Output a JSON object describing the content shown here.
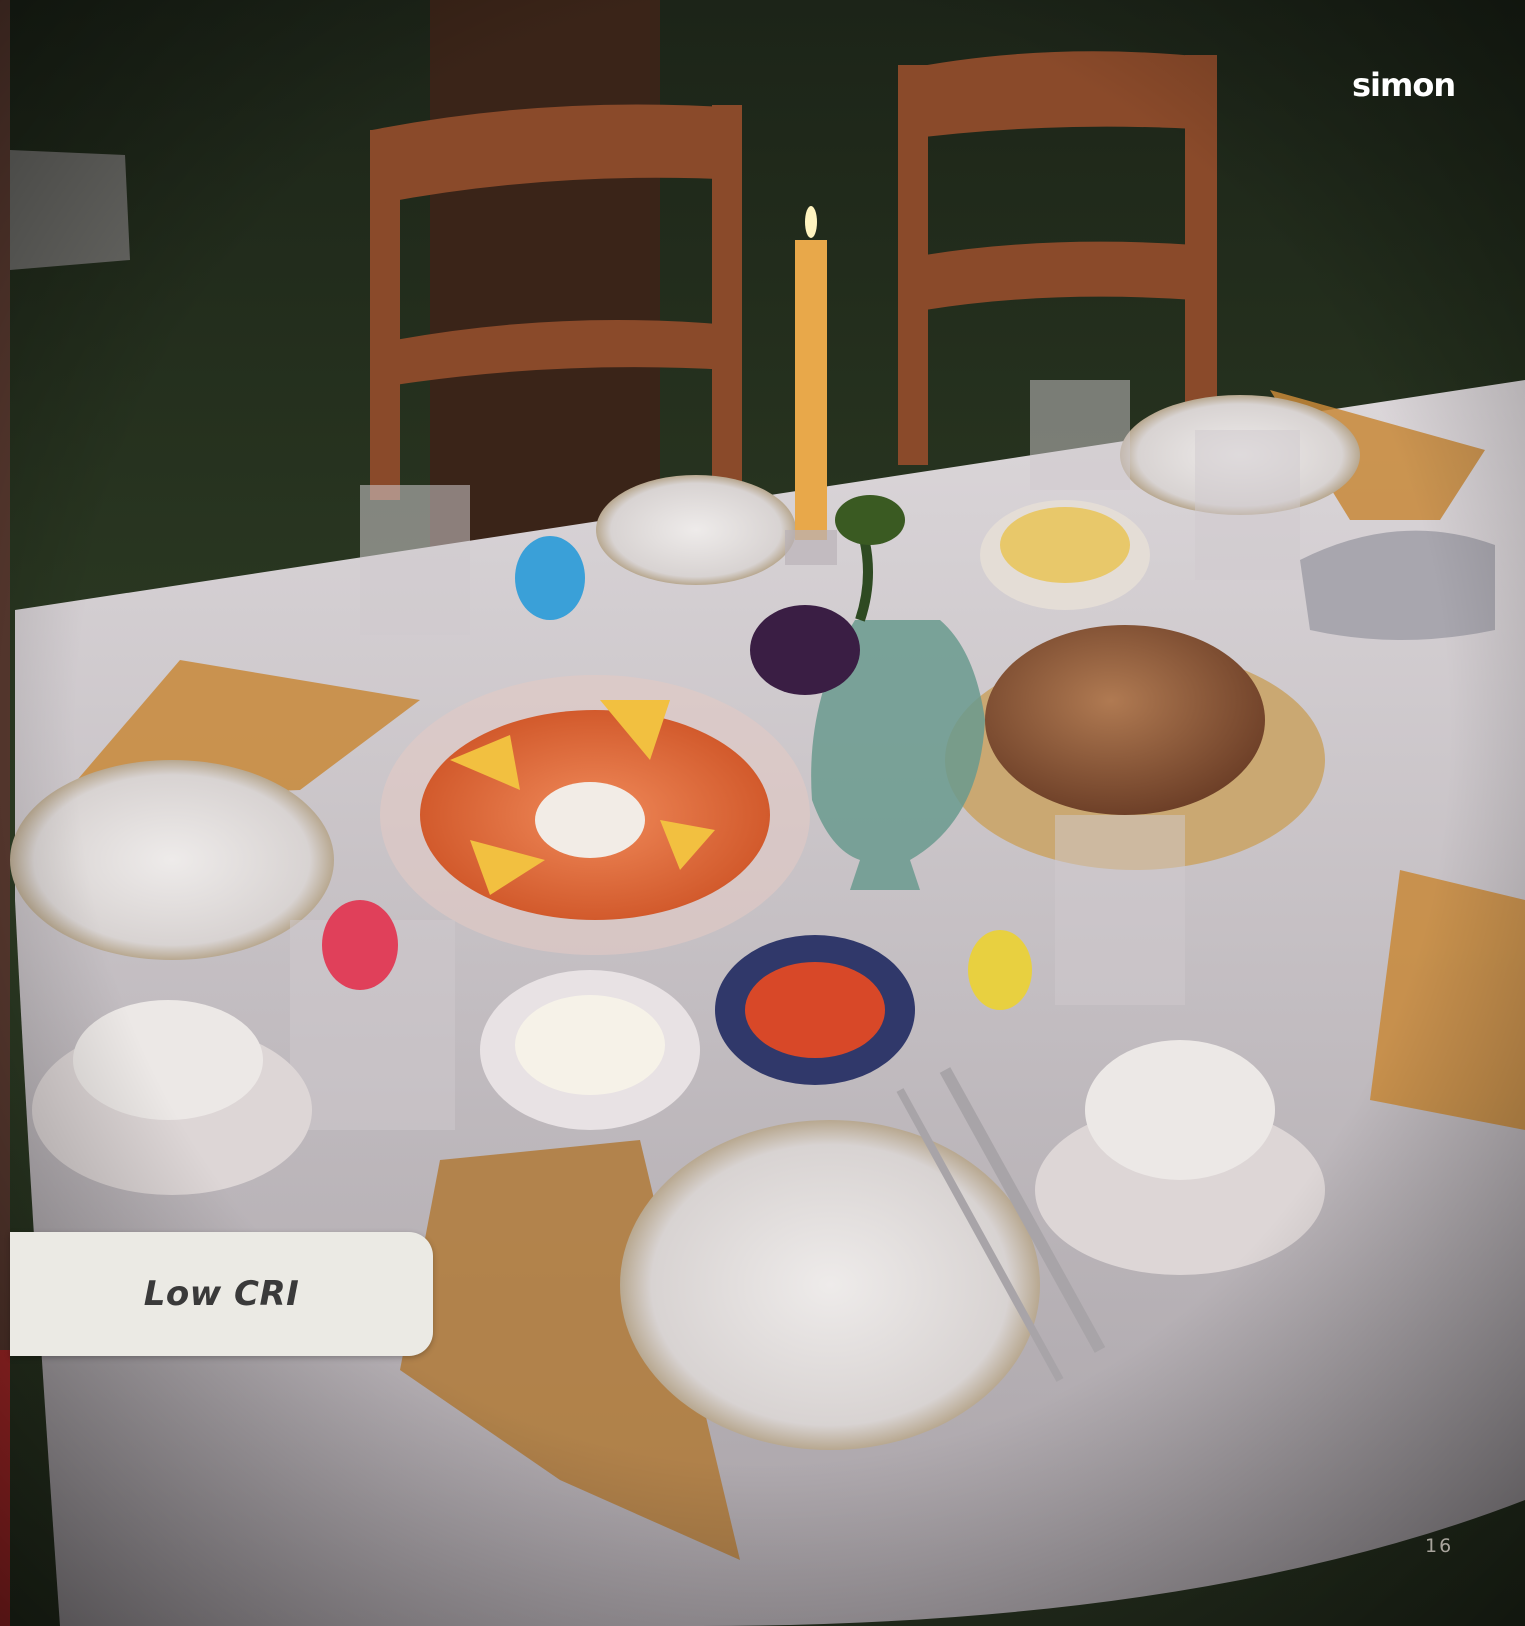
{
  "brand": {
    "name": "simon"
  },
  "label": {
    "text": "Low CRI"
  },
  "page": {
    "number": "16"
  },
  "colors": {
    "grass": "#2b3a22",
    "tablecloth": "#d9d4d6",
    "chair_wood": "#8a4a2a",
    "salmon": "#e06a3a",
    "bread": "#8c5a3a",
    "candle": "#e8a84a",
    "label_bg": "#ebeae4",
    "label_text": "#3a3a3a"
  }
}
